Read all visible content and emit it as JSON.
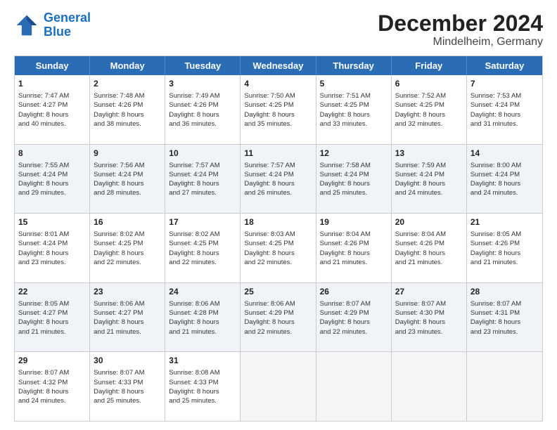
{
  "logo": {
    "line1": "General",
    "line2": "Blue"
  },
  "title": "December 2024",
  "subtitle": "Mindelheim, Germany",
  "weekdays": [
    "Sunday",
    "Monday",
    "Tuesday",
    "Wednesday",
    "Thursday",
    "Friday",
    "Saturday"
  ],
  "weeks": [
    [
      {
        "day": "1",
        "info": "Sunrise: 7:47 AM\nSunset: 4:27 PM\nDaylight: 8 hours\nand 40 minutes."
      },
      {
        "day": "2",
        "info": "Sunrise: 7:48 AM\nSunset: 4:26 PM\nDaylight: 8 hours\nand 38 minutes."
      },
      {
        "day": "3",
        "info": "Sunrise: 7:49 AM\nSunset: 4:26 PM\nDaylight: 8 hours\nand 36 minutes."
      },
      {
        "day": "4",
        "info": "Sunrise: 7:50 AM\nSunset: 4:25 PM\nDaylight: 8 hours\nand 35 minutes."
      },
      {
        "day": "5",
        "info": "Sunrise: 7:51 AM\nSunset: 4:25 PM\nDaylight: 8 hours\nand 33 minutes."
      },
      {
        "day": "6",
        "info": "Sunrise: 7:52 AM\nSunset: 4:25 PM\nDaylight: 8 hours\nand 32 minutes."
      },
      {
        "day": "7",
        "info": "Sunrise: 7:53 AM\nSunset: 4:24 PM\nDaylight: 8 hours\nand 31 minutes."
      }
    ],
    [
      {
        "day": "8",
        "info": "Sunrise: 7:55 AM\nSunset: 4:24 PM\nDaylight: 8 hours\nand 29 minutes."
      },
      {
        "day": "9",
        "info": "Sunrise: 7:56 AM\nSunset: 4:24 PM\nDaylight: 8 hours\nand 28 minutes."
      },
      {
        "day": "10",
        "info": "Sunrise: 7:57 AM\nSunset: 4:24 PM\nDaylight: 8 hours\nand 27 minutes."
      },
      {
        "day": "11",
        "info": "Sunrise: 7:57 AM\nSunset: 4:24 PM\nDaylight: 8 hours\nand 26 minutes."
      },
      {
        "day": "12",
        "info": "Sunrise: 7:58 AM\nSunset: 4:24 PM\nDaylight: 8 hours\nand 25 minutes."
      },
      {
        "day": "13",
        "info": "Sunrise: 7:59 AM\nSunset: 4:24 PM\nDaylight: 8 hours\nand 24 minutes."
      },
      {
        "day": "14",
        "info": "Sunrise: 8:00 AM\nSunset: 4:24 PM\nDaylight: 8 hours\nand 24 minutes."
      }
    ],
    [
      {
        "day": "15",
        "info": "Sunrise: 8:01 AM\nSunset: 4:24 PM\nDaylight: 8 hours\nand 23 minutes."
      },
      {
        "day": "16",
        "info": "Sunrise: 8:02 AM\nSunset: 4:25 PM\nDaylight: 8 hours\nand 22 minutes."
      },
      {
        "day": "17",
        "info": "Sunrise: 8:02 AM\nSunset: 4:25 PM\nDaylight: 8 hours\nand 22 minutes."
      },
      {
        "day": "18",
        "info": "Sunrise: 8:03 AM\nSunset: 4:25 PM\nDaylight: 8 hours\nand 22 minutes."
      },
      {
        "day": "19",
        "info": "Sunrise: 8:04 AM\nSunset: 4:26 PM\nDaylight: 8 hours\nand 21 minutes."
      },
      {
        "day": "20",
        "info": "Sunrise: 8:04 AM\nSunset: 4:26 PM\nDaylight: 8 hours\nand 21 minutes."
      },
      {
        "day": "21",
        "info": "Sunrise: 8:05 AM\nSunset: 4:26 PM\nDaylight: 8 hours\nand 21 minutes."
      }
    ],
    [
      {
        "day": "22",
        "info": "Sunrise: 8:05 AM\nSunset: 4:27 PM\nDaylight: 8 hours\nand 21 minutes."
      },
      {
        "day": "23",
        "info": "Sunrise: 8:06 AM\nSunset: 4:27 PM\nDaylight: 8 hours\nand 21 minutes."
      },
      {
        "day": "24",
        "info": "Sunrise: 8:06 AM\nSunset: 4:28 PM\nDaylight: 8 hours\nand 21 minutes."
      },
      {
        "day": "25",
        "info": "Sunrise: 8:06 AM\nSunset: 4:29 PM\nDaylight: 8 hours\nand 22 minutes."
      },
      {
        "day": "26",
        "info": "Sunrise: 8:07 AM\nSunset: 4:29 PM\nDaylight: 8 hours\nand 22 minutes."
      },
      {
        "day": "27",
        "info": "Sunrise: 8:07 AM\nSunset: 4:30 PM\nDaylight: 8 hours\nand 23 minutes."
      },
      {
        "day": "28",
        "info": "Sunrise: 8:07 AM\nSunset: 4:31 PM\nDaylight: 8 hours\nand 23 minutes."
      }
    ],
    [
      {
        "day": "29",
        "info": "Sunrise: 8:07 AM\nSunset: 4:32 PM\nDaylight: 8 hours\nand 24 minutes."
      },
      {
        "day": "30",
        "info": "Sunrise: 8:07 AM\nSunset: 4:33 PM\nDaylight: 8 hours\nand 25 minutes."
      },
      {
        "day": "31",
        "info": "Sunrise: 8:08 AM\nSunset: 4:33 PM\nDaylight: 8 hours\nand 25 minutes."
      },
      {
        "day": "",
        "info": ""
      },
      {
        "day": "",
        "info": ""
      },
      {
        "day": "",
        "info": ""
      },
      {
        "day": "",
        "info": ""
      }
    ]
  ]
}
